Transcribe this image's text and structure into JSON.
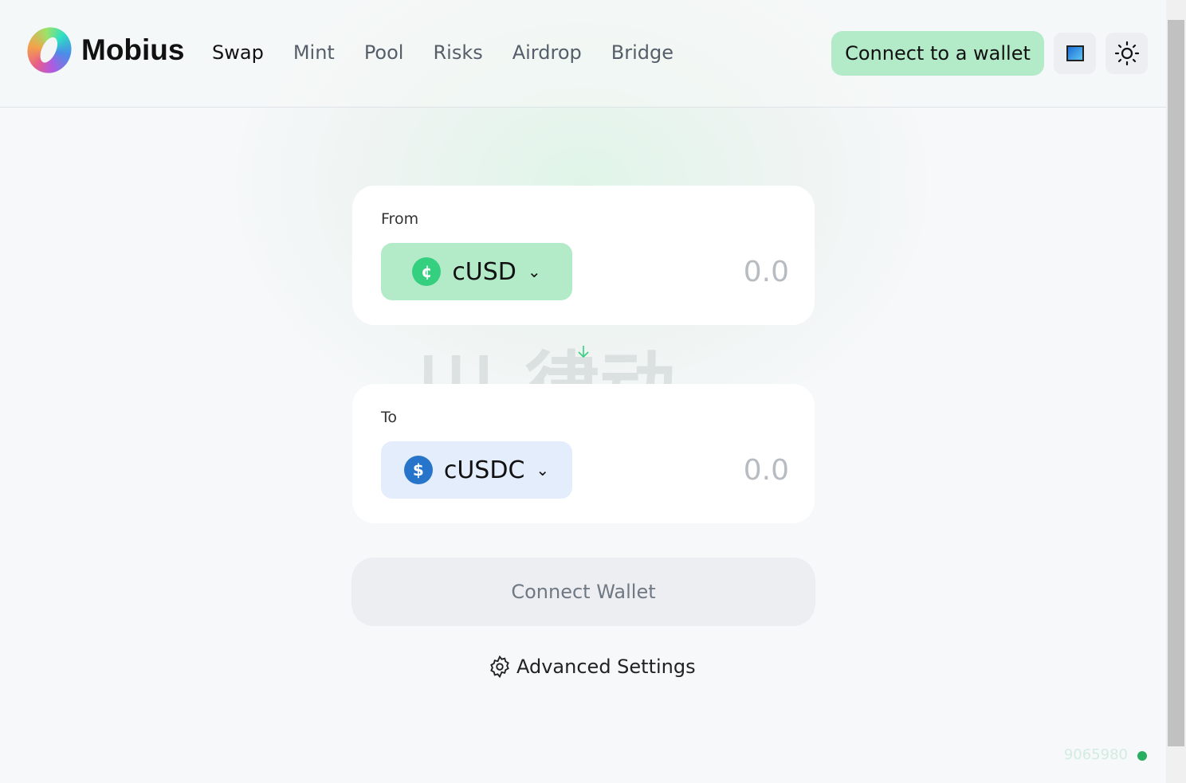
{
  "app": {
    "name": "Mobius",
    "watermark": "律动 BLOCKBEATS"
  },
  "nav": {
    "items": [
      {
        "label": "Swap",
        "active": true
      },
      {
        "label": "Mint"
      },
      {
        "label": "Pool"
      },
      {
        "label": "Risks"
      },
      {
        "label": "Airdrop"
      },
      {
        "label": "Bridge"
      }
    ]
  },
  "header": {
    "connect_label": "Connect to a wallet",
    "network_icon": "network-image-icon",
    "theme_icon": "sun-icon"
  },
  "swap": {
    "from": {
      "label": "From",
      "token": "cUSD",
      "amount": "0.0",
      "token_color": "#b3eac8",
      "coin_color": "#35d07f"
    },
    "to": {
      "label": "To",
      "token": "cUSDC",
      "amount": "0.0",
      "token_color": "#e3edfb",
      "coin_color": "#2775ca"
    },
    "connect_wallet_label": "Connect Wallet",
    "advanced_settings_label": "Advanced Settings"
  },
  "footer": {
    "block_number": "9065980",
    "status_color": "#27ae60"
  }
}
